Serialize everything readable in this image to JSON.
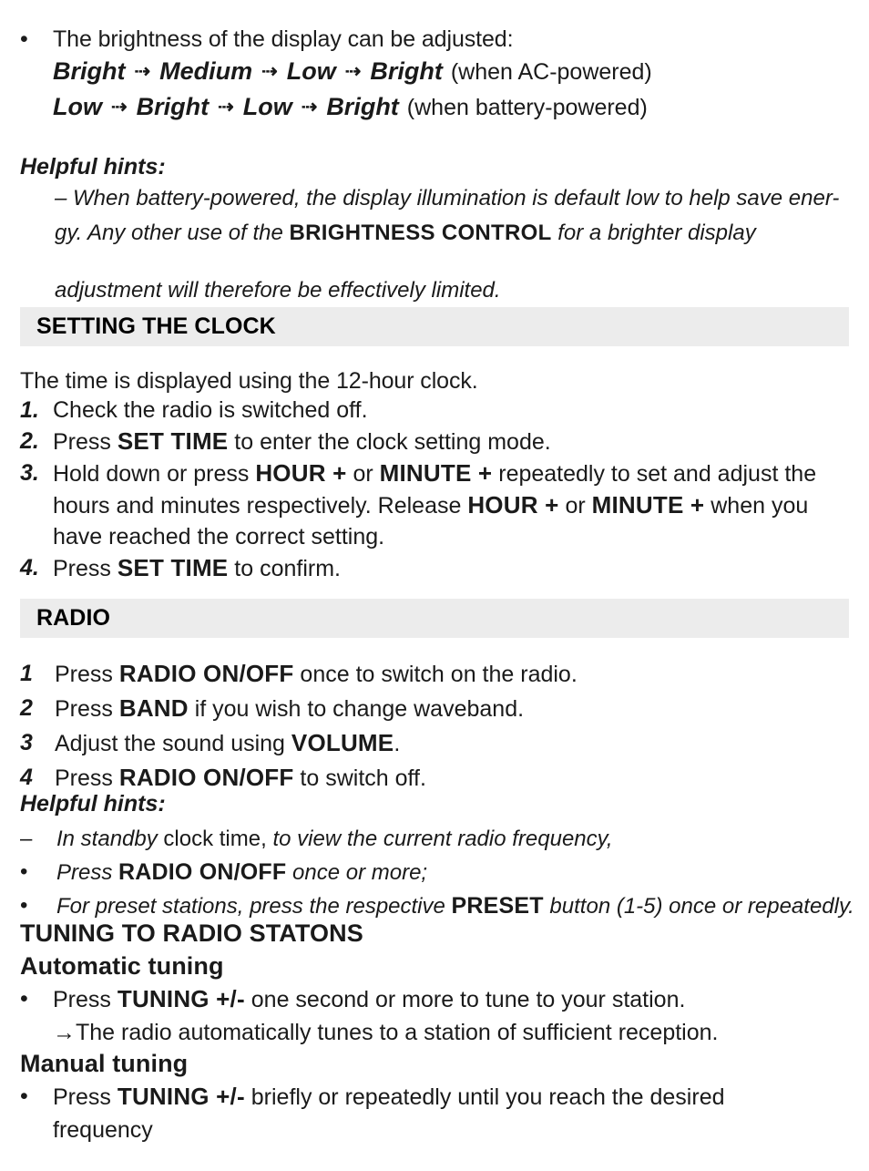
{
  "page": {
    "background": "#ffffff",
    "band_color": "#ececec",
    "text_color": "#1c1c1c"
  },
  "brightness": {
    "bullet": "•",
    "intro": "The brightness of the display can be adjusted:",
    "arrow_glyph": "⇢",
    "chain_ac": {
      "steps": [
        "Bright",
        "Medium",
        "Low",
        "Bright"
      ],
      "note": "(when AC-powered)"
    },
    "chain_battery": {
      "steps": [
        "Low",
        "Bright",
        "Low",
        "Bright"
      ],
      "note": "(when battery-powered)"
    }
  },
  "hints_brightness": {
    "title": "Helpful hints:",
    "dash": "–",
    "line1_a": "When battery-powered, the display illumination is default low to help save ener-",
    "line2_a": "gy. Any other use of the",
    "line2_bold": "BRIGHTNESS CONTROL",
    "line2_b": "for a brighter display",
    "line3": "adjustment will therefore be effectively limited."
  },
  "clock_section": {
    "heading": "SETTING THE CLOCK",
    "intro": "The time is displayed using the 12-hour clock.",
    "steps": [
      {
        "num": "1.",
        "parts": [
          {
            "t": "Check the radio is switched off.",
            "s": "normal"
          }
        ]
      },
      {
        "num": "2.",
        "parts": [
          {
            "t": "Press ",
            "s": "normal"
          },
          {
            "t": "SET TIME",
            "s": "bold"
          },
          {
            "t": " to enter the clock setting mode.",
            "s": "normal"
          }
        ]
      },
      {
        "num": "3.",
        "parts": [
          {
            "t": "Hold down or press ",
            "s": "normal"
          },
          {
            "t": "HOUR +",
            "s": "bold"
          },
          {
            "t": " or ",
            "s": "normal"
          },
          {
            "t": "MINUTE +",
            "s": "bold"
          },
          {
            "t": " repeatedly to set and adjust the hours and minutes respectively. Release ",
            "s": "normal"
          },
          {
            "t": "HOUR +",
            "s": "bold"
          },
          {
            "t": " or ",
            "s": "normal"
          },
          {
            "t": "MINUTE +",
            "s": "bold"
          },
          {
            "t": " when you have reached the correct setting.",
            "s": "normal"
          }
        ]
      },
      {
        "num": "4.",
        "parts": [
          {
            "t": "Press ",
            "s": "normal"
          },
          {
            "t": "SET TIME",
            "s": "bold"
          },
          {
            "t": " to confirm.",
            "s": "normal"
          }
        ]
      }
    ]
  },
  "radio_section": {
    "heading": "RADIO",
    "steps": [
      {
        "num": "1",
        "parts": [
          {
            "t": "Press ",
            "s": "normal"
          },
          {
            "t": "RADIO ON/OFF",
            "s": "bold"
          },
          {
            "t": " once to switch on the radio.",
            "s": "normal"
          }
        ]
      },
      {
        "num": "2",
        "parts": [
          {
            "t": "Press ",
            "s": "normal"
          },
          {
            "t": "BAND",
            "s": "bold"
          },
          {
            "t": " if you wish to change waveband.",
            "s": "normal"
          }
        ]
      },
      {
        "num": "3",
        "parts": [
          {
            "t": "Adjust the sound using ",
            "s": "normal"
          },
          {
            "t": "VOLUME",
            "s": "bold"
          },
          {
            "t": ".",
            "s": "normal"
          }
        ]
      },
      {
        "num": "4",
        "parts": [
          {
            "t": "Press ",
            "s": "normal"
          },
          {
            "t": "RADIO ON/OFF",
            "s": "bold"
          },
          {
            "t": " to switch off.",
            "s": "normal"
          }
        ]
      }
    ]
  },
  "hints_radio": {
    "title": "Helpful hints:",
    "items": [
      {
        "marker": "–",
        "parts": [
          {
            "t": "In standby",
            "s": "italic"
          },
          {
            "t": " clock time,",
            "s": "upright"
          },
          {
            "t": " to view the current radio frequency,",
            "s": "italic"
          }
        ]
      },
      {
        "marker": "•",
        "parts": [
          {
            "t": "Press ",
            "s": "italic"
          },
          {
            "t": "RADIO ON/OFF",
            "s": "bold"
          },
          {
            "t": " once or more;",
            "s": "italic"
          }
        ]
      },
      {
        "marker": "•",
        "parts": [
          {
            "t": "For preset stations, press the respective ",
            "s": "italic"
          },
          {
            "t": "PRESET",
            "s": "bold"
          },
          {
            "t": " button (1-5) once or repeatedly.",
            "s": "italic"
          }
        ]
      }
    ]
  },
  "tuning_section": {
    "heading": "TUNING TO RADIO STATONS",
    "automatic": {
      "title": "Automatic tuning",
      "bullet": "•",
      "parts": [
        {
          "t": "Press ",
          "s": "normal"
        },
        {
          "t": "TUNING +/-",
          "s": "bold"
        },
        {
          "t": " one second or more to tune to your station.",
          "s": "normal"
        }
      ],
      "result_arrow": "→",
      "result": "The radio automatically tunes to a station of sufficient reception."
    },
    "manual": {
      "title": "Manual tuning",
      "bullet": "•",
      "parts": [
        {
          "t": "Press ",
          "s": "normal"
        },
        {
          "t": "TUNING +/-",
          "s": "bold"
        },
        {
          "t": " briefly or repeatedly until you reach the desired frequency",
          "s": "normal"
        }
      ]
    }
  }
}
